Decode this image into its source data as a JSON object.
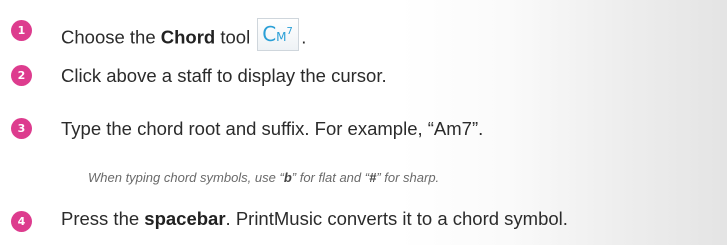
{
  "steps": [
    {
      "number": "1",
      "prefix": "Choose the ",
      "bold": "Chord",
      "suffix": " tool",
      "after_icon": ".",
      "tool_icon": {
        "name": "chord-tool-icon",
        "root": "C",
        "quality": "M",
        "extension": "7",
        "color": "#2a9fd6"
      }
    },
    {
      "number": "2",
      "text": "Click above a staff to display the cursor."
    },
    {
      "number": "3",
      "text": "Type the chord root and suffix. For example, “Am7”."
    },
    {
      "number": "4",
      "bold": "spacebar",
      "prefix": "Press the ",
      "suffix": ". PrintMusic converts it to a chord symbol."
    }
  ],
  "note": {
    "part1": "When typing chord symbols, use “",
    "flat_key": "b",
    "part2": "” for flat and “",
    "sharp_key": "#",
    "part3": "” for sharp."
  },
  "colors": {
    "badge": "#dd3c8e",
    "text": "#2b2b2b",
    "note": "#6a6a6a",
    "icon": "#2a9fd6"
  }
}
